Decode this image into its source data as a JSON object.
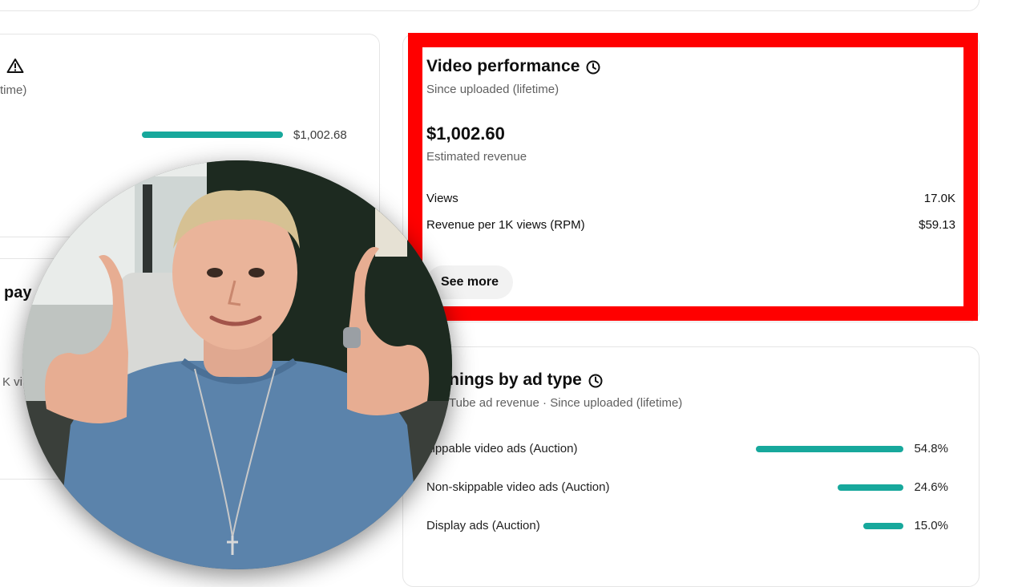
{
  "left_panel": {
    "subtitle_fragment": "time)",
    "revenue_value": "$1,002.68",
    "revenue_bar_fraction": 1.0,
    "heading_fragment": "pay",
    "views_fragment": "K vi"
  },
  "video_performance": {
    "title": "Video performance",
    "subtitle": "Since uploaded (lifetime)",
    "amount": "$1,002.60",
    "amount_label": "Estimated revenue",
    "views_label": "Views",
    "views_value": "17.0K",
    "rpm_label": "Revenue per 1K views (RPM)",
    "rpm_value": "$59.13",
    "see_more": "See more",
    "highlight_color": "#ff0000"
  },
  "earnings_by_ad_type": {
    "title": "rnings by ad type",
    "subtitle": "Tube ad revenue · Since uploaded (lifetime)",
    "rows": [
      {
        "label": "kippable video ads (Auction)",
        "value": "54.8%",
        "fraction": 0.548
      },
      {
        "label": "Non-skippable video ads (Auction)",
        "value": "24.6%",
        "fraction": 0.246
      },
      {
        "label": "Display ads (Auction)",
        "value": "15.0%",
        "fraction": 0.15
      }
    ],
    "bar_color": "#17a89c"
  },
  "icons": {
    "warning": "warning-icon",
    "clock": "clock-icon"
  }
}
